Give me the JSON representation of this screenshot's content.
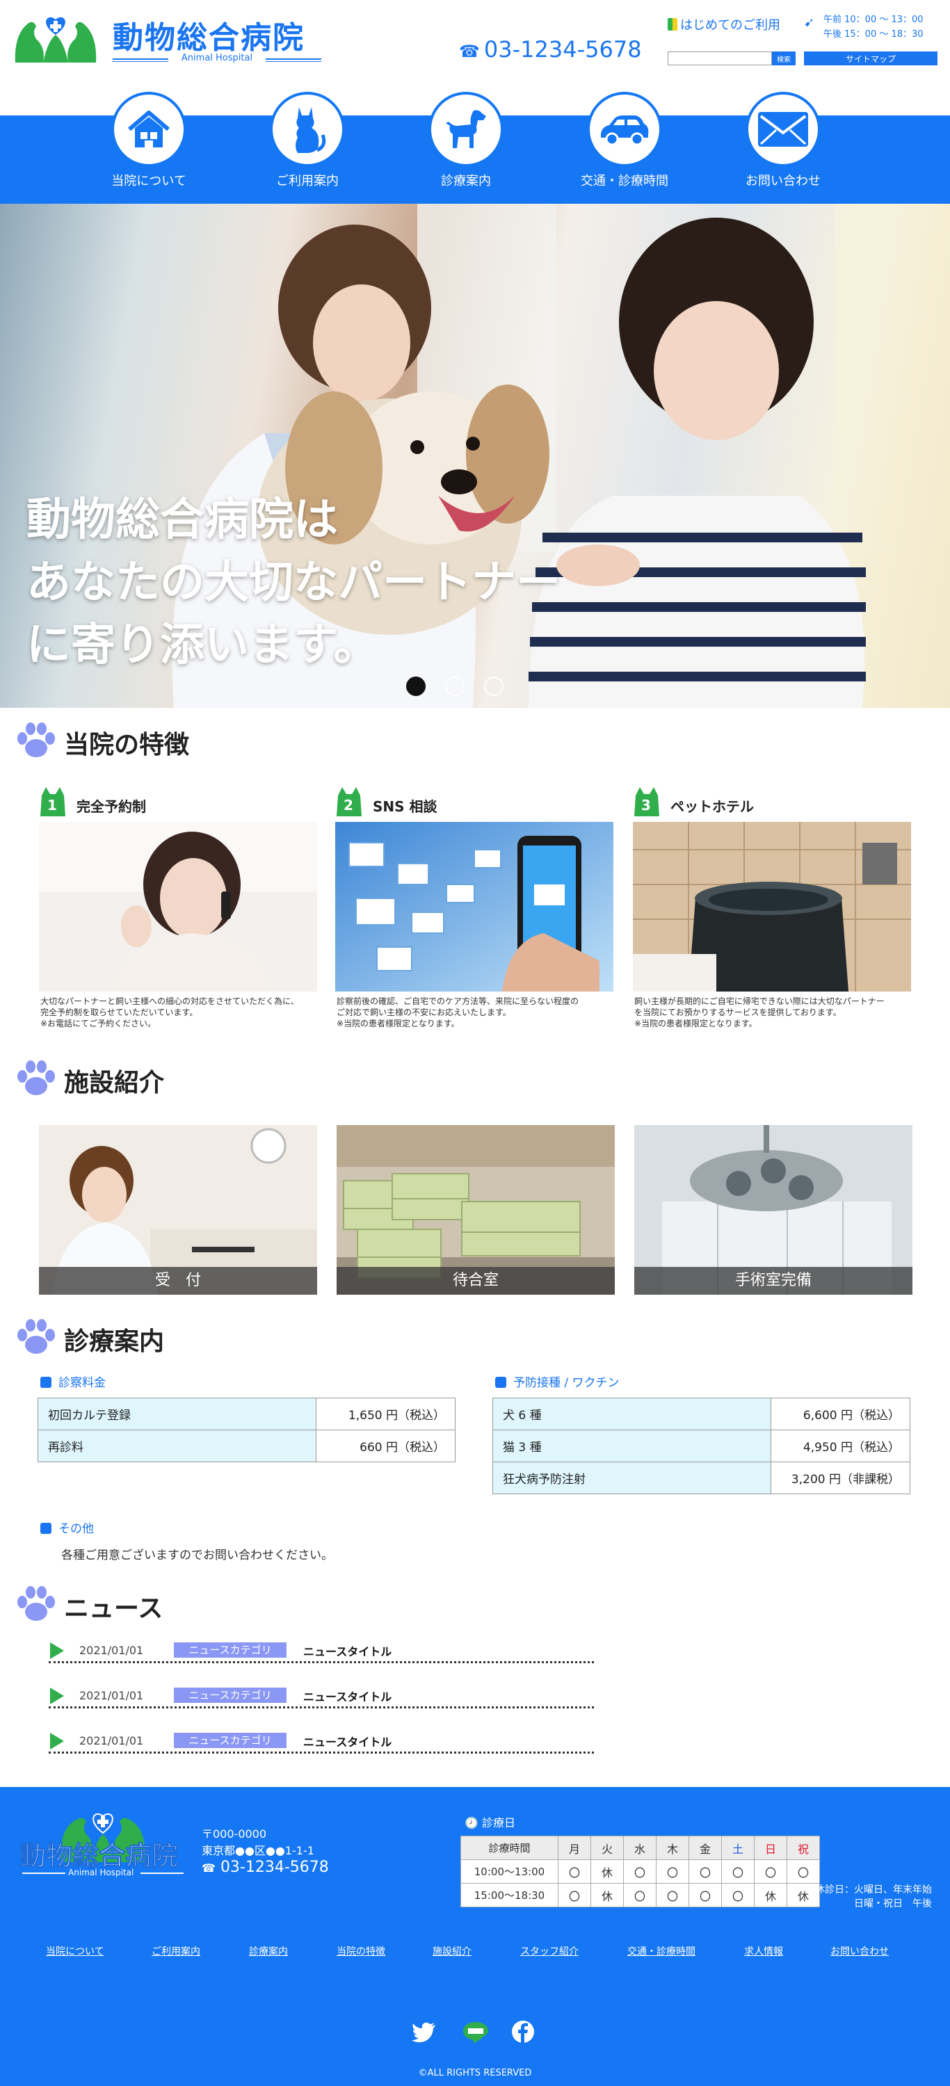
{
  "header": {
    "logo_title": "動物総合病院",
    "logo_sub": "Animal Hospital",
    "phone": "03-1234-5678",
    "beginner_link": "はじめてのご利用",
    "hours_am": "午前 10：00 〜 13：00",
    "hours_pm": "午後 15：00 〜 18：30",
    "search_placeholder": "",
    "search_button": "検索",
    "sitemap_button": "サイトマップ"
  },
  "nav": [
    {
      "label": "当院について",
      "icon": "house-icon"
    },
    {
      "label": "ご利用案内",
      "icon": "cat-icon"
    },
    {
      "label": "診療案内",
      "icon": "dog-icon"
    },
    {
      "label": "交通・診療時間",
      "icon": "car-icon"
    },
    {
      "label": "お問い合わせ",
      "icon": "mail-icon"
    }
  ],
  "hero": {
    "line1": "動物総合病院は",
    "line2": "あなたの大切なパートナー",
    "line3": "に寄り添います。",
    "slides": 3,
    "active_slide": 1
  },
  "features": {
    "heading": "当院の特徴",
    "items": [
      {
        "num": "1",
        "title": "完全予約制",
        "desc1": "大切なパートナーと飼い主様への細心の対応をさせていただく為に、",
        "desc2": "完全予約制を取らせていただいています。",
        "desc3": "※お電話にてご予約ください。"
      },
      {
        "num": "2",
        "title": "SNS 相談",
        "desc1": "診察前後の確認、ご自宅でのケア方法等、来院に至らない程度の",
        "desc2": "ご対応で飼い主様の不安にお応えいたします。",
        "desc3": "※当院の患者様限定となります。"
      },
      {
        "num": "3",
        "title": "ペットホテル",
        "desc1": "飼い主様が長期的にご自宅に帰宅できない際には大切なパートナー",
        "desc2": "を当院にてお預かりするサービスを提供しております。",
        "desc3": "※当院の患者様限定となります。"
      }
    ]
  },
  "facility": {
    "heading": "施設紹介",
    "items": [
      {
        "caption": "受　付"
      },
      {
        "caption": "待合室"
      },
      {
        "caption": "手術室完備"
      }
    ]
  },
  "clinic": {
    "heading": "診療案内",
    "fees_title": "診察料金",
    "fees": [
      {
        "name": "初回カルテ登録",
        "price": "1,650 円（税込）"
      },
      {
        "name": "再診料",
        "price": "660 円（税込）"
      }
    ],
    "vaccine_title": "予防接種 / ワクチン",
    "vaccines": [
      {
        "name": "犬 6 種",
        "price": "6,600 円（税込）"
      },
      {
        "name": "猫 3 種",
        "price": "4,950 円（税込）"
      },
      {
        "name": "狂犬病予防注射",
        "price": "3,200 円（非課税）"
      }
    ],
    "other_title": "その他",
    "other_text": "各種ご用意ございますのでお問い合わせください。"
  },
  "news": {
    "heading": "ニュース",
    "items": [
      {
        "date": "2021/01/01",
        "category": "ニュースカテゴリ",
        "title": "ニュースタイトル"
      },
      {
        "date": "2021/01/01",
        "category": "ニュースカテゴリ",
        "title": "ニュースタイトル"
      },
      {
        "date": "2021/01/01",
        "category": "ニュースカテゴリ",
        "title": "ニュースタイトル"
      }
    ]
  },
  "footer": {
    "logo_title": "動物総合病院",
    "logo_sub": "Animal Hospital",
    "postal": "〒000-0000",
    "address": "東京都●●区●●1-1-1",
    "phone": "03-1234-5678",
    "schedule_label": "診療日",
    "schedule_header": [
      "診療時間",
      "月",
      "火",
      "水",
      "木",
      "金",
      "土",
      "日",
      "祝"
    ],
    "schedule_rows": [
      [
        "10:00〜13:00",
        "〇",
        "休",
        "〇",
        "〇",
        "〇",
        "〇",
        "〇",
        "〇"
      ],
      [
        "15:00〜18:30",
        "〇",
        "休",
        "〇",
        "〇",
        "〇",
        "〇",
        "休",
        "休"
      ]
    ],
    "note1": "休診日：火曜日、年末年始",
    "note2": "日曜・祝日　午後",
    "links": [
      "当院について",
      "ご利用案内",
      "診療案内",
      "当院の特徴",
      "施設紹介",
      "スタッフ紹介",
      "交通・診療時間",
      "求人情報",
      "お問い合わせ"
    ],
    "sns": [
      "twitter-icon",
      "line-icon",
      "facebook-icon"
    ],
    "copyright": "©ALL RIGHTS RESERVED"
  },
  "colors": {
    "brand_blue": "#1577f3",
    "accent_green": "#2fae4b",
    "paw_purple": "#8a97f4",
    "fee_row_bg": "#dff6fd",
    "holiday_red": "#e0182d",
    "saturday_blue": "#1a55d8"
  }
}
